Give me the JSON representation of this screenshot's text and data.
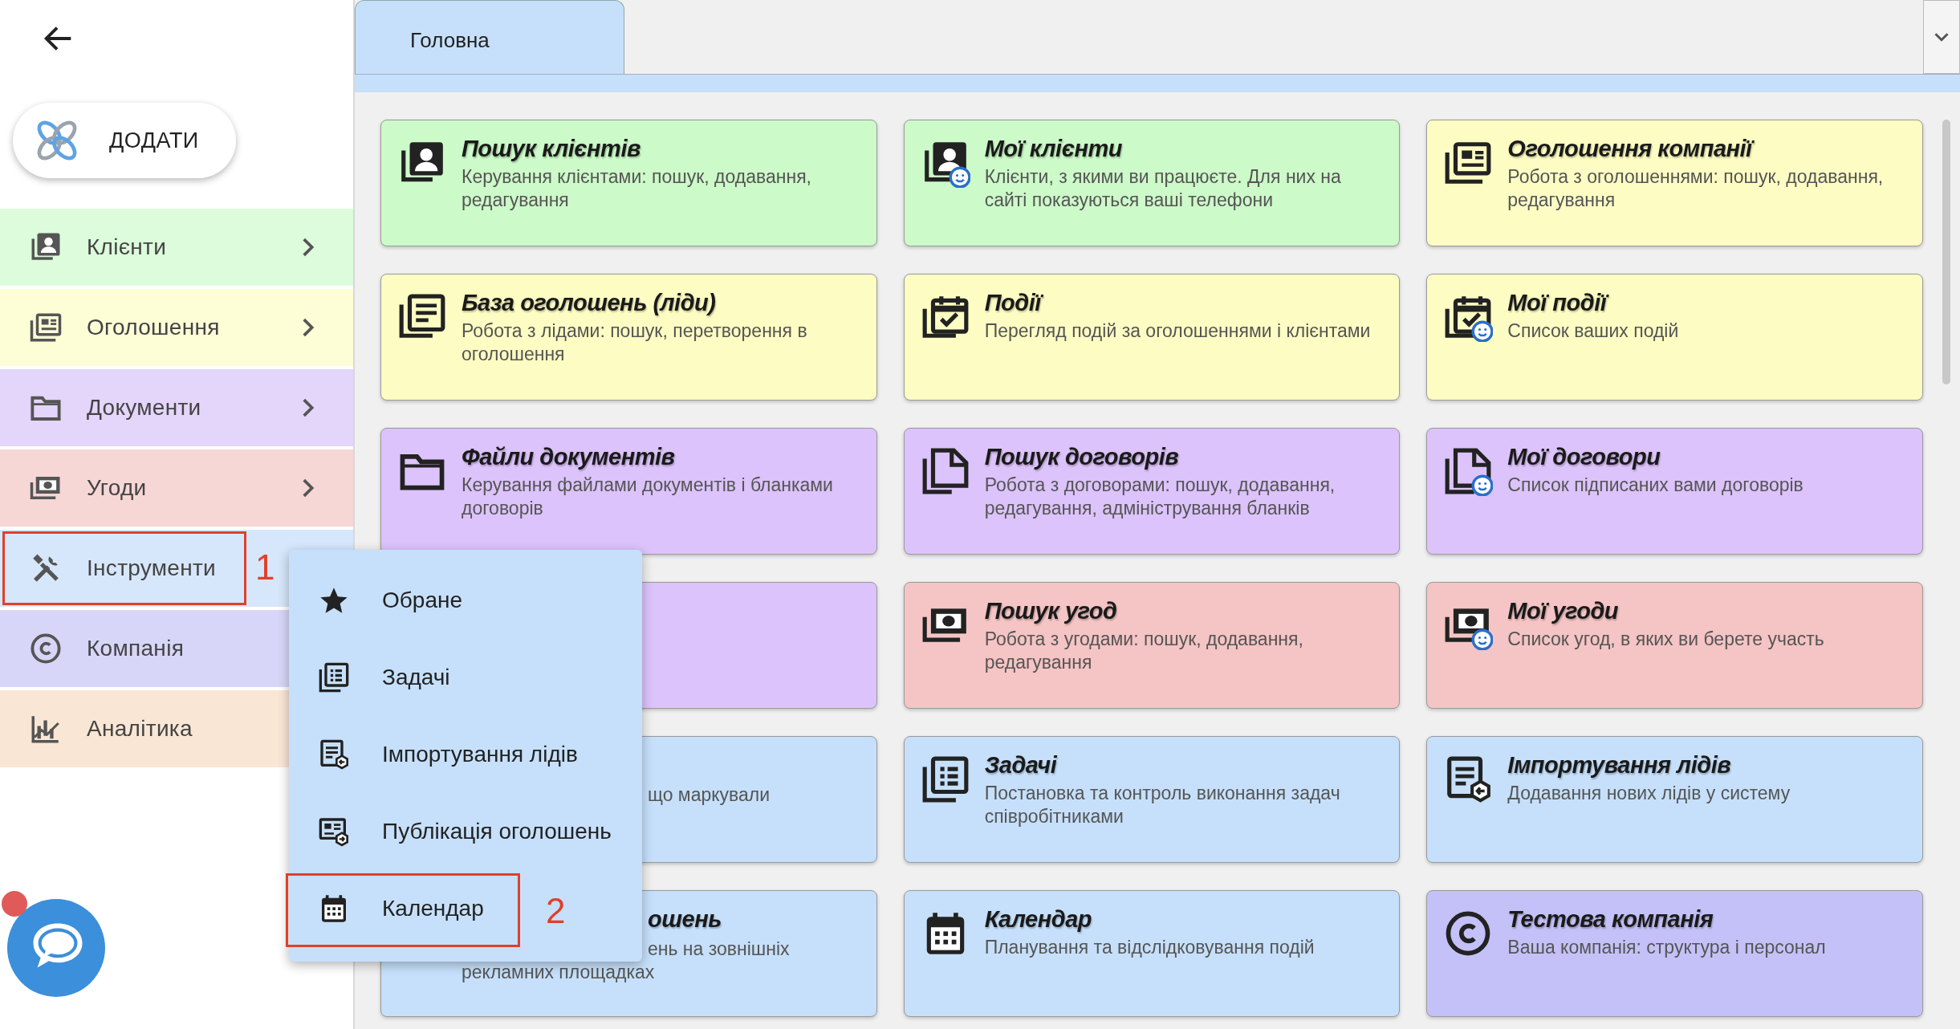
{
  "sidebar": {
    "add_button": "ДОДАТИ",
    "items": [
      {
        "label": "Клієнти",
        "kind": "contacts",
        "color": "#dcfcdc",
        "has_submenu": true,
        "highlighted": false
      },
      {
        "label": "Оголошення",
        "kind": "newspaper",
        "color": "#fdfdd6",
        "has_submenu": true,
        "highlighted": false
      },
      {
        "label": "Документи",
        "kind": "folder",
        "color": "#e4d5fb",
        "has_submenu": true,
        "highlighted": false
      },
      {
        "label": "Угоди",
        "kind": "money",
        "color": "#f7d6d6",
        "has_submenu": true,
        "highlighted": false
      },
      {
        "label": "Інструменти",
        "kind": "tools",
        "color": "#d6e7fb",
        "has_submenu": false,
        "highlighted": true,
        "annotation": "1"
      },
      {
        "label": "Компанія",
        "kind": "copyright",
        "color": "#d7d6f9",
        "has_submenu": false,
        "highlighted": false
      },
      {
        "label": "Аналітика",
        "kind": "chart",
        "color": "#fae6d5",
        "has_submenu": false,
        "highlighted": false
      }
    ]
  },
  "chat": {
    "unread": true
  },
  "tabs": [
    {
      "label": "Головна",
      "selected": true
    }
  ],
  "tiles": [
    {
      "color": "#ccfac8",
      "kind": "contacts",
      "title": "Пошук клієнтів",
      "description": "Керування клієнтами: пошук, додавання, редагування"
    },
    {
      "color": "#ccfac8",
      "kind": "contacts-smile",
      "title": "Мої клієнти",
      "description": "Клієнти, з якими ви працюєте. Для них на сайті показуються ваші телефони"
    },
    {
      "color": "#fdfdc3",
      "kind": "newspaper",
      "title": "Оголошення компанії",
      "description": "Робота з оголошеннями: пошук, додавання, редагування"
    },
    {
      "color": "#fdfdc3",
      "kind": "list",
      "title": "База оголошень (ліди)",
      "description": "Робота з лідами: пошук, перетворення в оголошення"
    },
    {
      "color": "#fdfdc3",
      "kind": "event",
      "title": "Події",
      "description": "Перегляд подій за оголошеннями і клієнтами"
    },
    {
      "color": "#fdfdc3",
      "kind": "event-smile",
      "title": "Мої події",
      "description": "Список ваших подій"
    },
    {
      "color": "#dcc3fb",
      "kind": "folder",
      "title": "Файли документів",
      "description": "Керування файлами документів і бланками договорів"
    },
    {
      "color": "#dcc3fb",
      "kind": "document",
      "title": "Пошук договорів",
      "description": "Робота з договорами: пошук, додавання, редагування, адміністрування бланків"
    },
    {
      "color": "#dcc3fb",
      "kind": "document-smile",
      "title": "Мої договори",
      "description": "Список підписаних вами договорів"
    },
    {
      "color": "#dcc3fb",
      "kind": "covered"
    },
    {
      "color": "#f5c4c4",
      "kind": "money",
      "title": "Пошук угод",
      "description": "Робота з угодами: пошук, додавання, редагування"
    },
    {
      "color": "#f5c4c4",
      "kind": "money-smile",
      "title": "Мої угоди",
      "description": "Список угод, в яких ви берете участь"
    },
    {
      "color": "#c6e0fb",
      "kind": "covered",
      "lines": [
        {
          "text": "що маркували",
          "covered": true
        }
      ]
    },
    {
      "color": "#c6e0fb",
      "kind": "tasks",
      "title": "Задачі",
      "description": "Постановка та контроль виконання задач співробітниками"
    },
    {
      "color": "#c6e0fb",
      "kind": "import",
      "title": "Імпортування лідів",
      "description": "Додавання нових лідів у систему"
    },
    {
      "color": "#c6e0fb",
      "kind": "covered",
      "title": "ошень",
      "lines": [
        {
          "text": "ень на зовнішніх",
          "covered": true
        },
        {
          "text": "рекламних площадках",
          "covered": false
        }
      ]
    },
    {
      "color": "#c6e0fb",
      "kind": "calendar",
      "title": "Календар",
      "description": "Планування та відслідковування подій"
    },
    {
      "color": "#c4c1f8",
      "kind": "copyright",
      "title": "Тестова компанія",
      "description": "Ваша компанія: структура і персонал"
    }
  ],
  "submenu": {
    "items": [
      {
        "label": "Обране",
        "kind": "star",
        "highlighted": false
      },
      {
        "label": "Задачі",
        "kind": "tasks",
        "highlighted": false
      },
      {
        "label": "Імпортування лідів",
        "kind": "import",
        "highlighted": false
      },
      {
        "label": "Публікація оголошень",
        "kind": "publish",
        "highlighted": false
      },
      {
        "label": "Календар",
        "kind": "calendar",
        "highlighted": true,
        "annotation": "2"
      }
    ]
  }
}
